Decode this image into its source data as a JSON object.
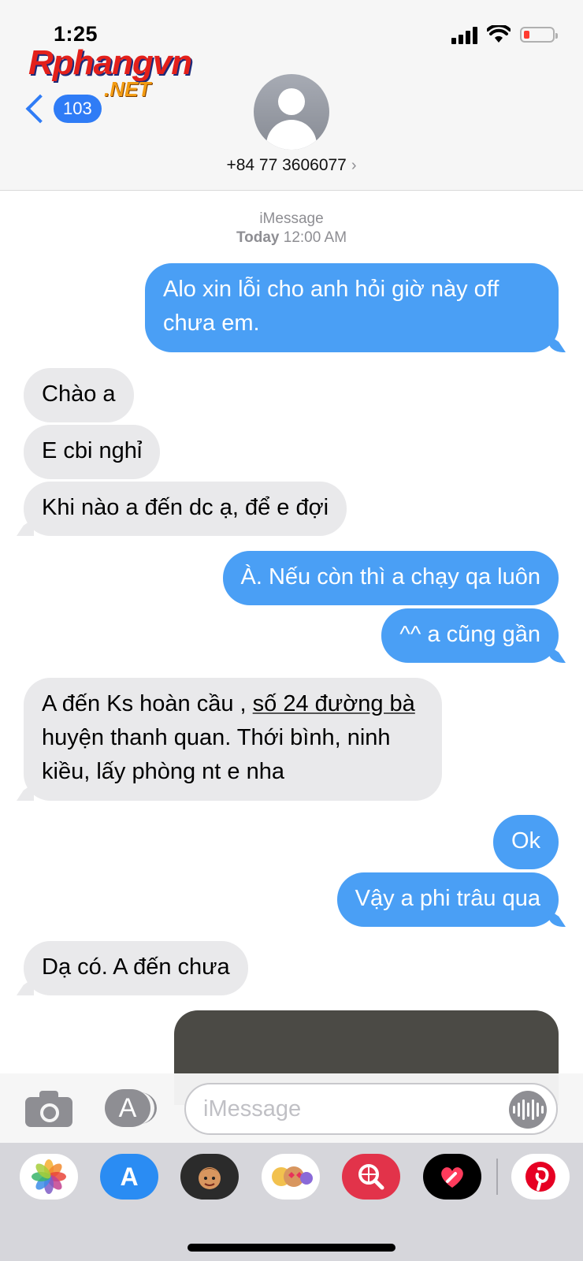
{
  "status_bar": {
    "time": "1:25"
  },
  "watermark": {
    "main": "Rphangvn",
    "sub": ".NET"
  },
  "nav": {
    "back_count": "103",
    "contact": "+84 77 3606077",
    "contact_chevron": "›"
  },
  "thread_meta": {
    "service": "iMessage",
    "day": "Today",
    "time": "12:00 AM"
  },
  "messages": [
    {
      "dir": "out",
      "text": "Alo xin lỗi cho anh hỏi giờ này off chưa em."
    },
    {
      "dir": "in",
      "text": "Chào a"
    },
    {
      "dir": "in",
      "text": "E cbi nghỉ"
    },
    {
      "dir": "in",
      "text": "Khi nào a đến dc ạ, để e đợi"
    },
    {
      "dir": "out",
      "text": "À. Nếu còn thì a chạy qa luôn"
    },
    {
      "dir": "out",
      "text": "^^ a cũng gần"
    },
    {
      "dir": "in",
      "text_before": "A đến Ks hoàn cầu , ",
      "link": "số 24 đường bà",
      "text_after": " huyện thanh quan. Thới bình, ninh kiều, lấy phòng nt e nha"
    },
    {
      "dir": "out",
      "text": "Ok"
    },
    {
      "dir": "out",
      "text": "Vậy a phi trâu qua"
    },
    {
      "dir": "in",
      "text": "Dạ có. A đến chưa"
    }
  ],
  "compose": {
    "placeholder": "iMessage"
  },
  "drawer_apps": [
    "photos-icon",
    "app-store-icon",
    "memoji-icon",
    "animoji-stickers-icon",
    "image-search-icon",
    "digital-touch-icon",
    "pinterest-icon"
  ],
  "colors": {
    "outgoing": "#4a9ff5",
    "incoming": "#e9e9eb",
    "accent": "#2f7cf6"
  }
}
